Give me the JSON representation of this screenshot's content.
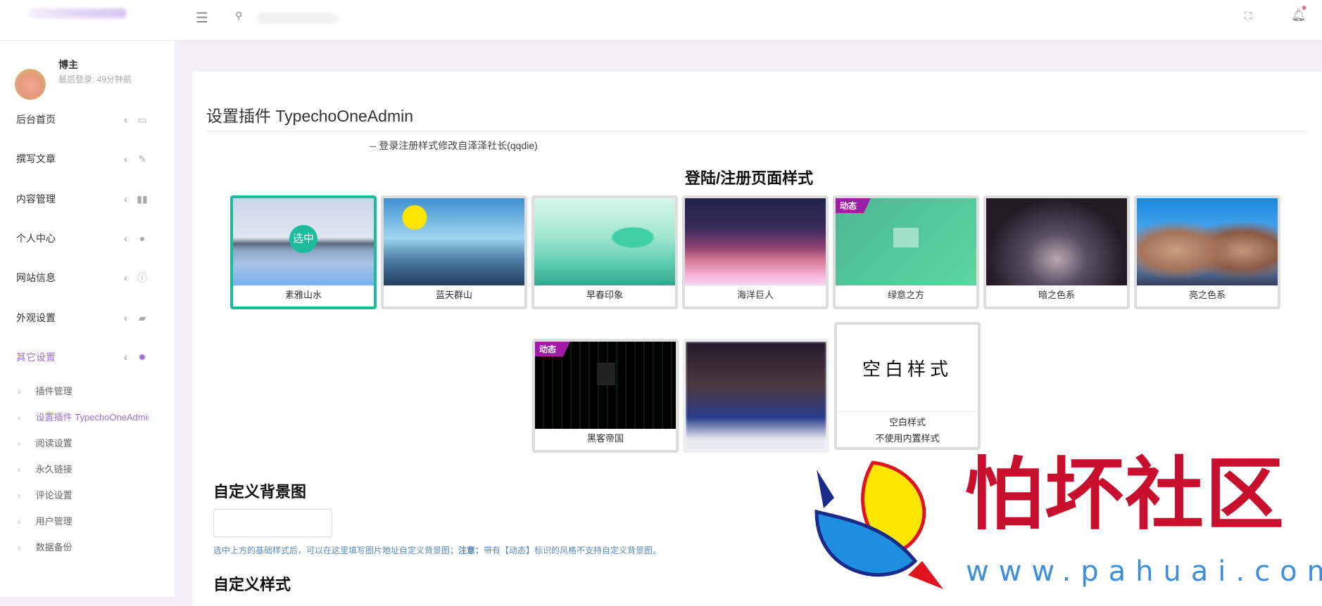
{
  "header": {
    "menu_icon": "hamburger-icon",
    "search_icon": "search-icon",
    "fullscreen_icon": "fullscreen-icon",
    "bell_icon": "bell-icon"
  },
  "user": {
    "name": "博主",
    "last_login": "最后登录: 49分钟前"
  },
  "sidebar": {
    "items": [
      {
        "label": "后台首页",
        "icon": "monitor-icon"
      },
      {
        "label": "撰写文章",
        "icon": "pencil-icon"
      },
      {
        "label": "内容管理",
        "icon": "book-icon"
      },
      {
        "label": "个人中心",
        "icon": "user-icon"
      },
      {
        "label": "网站信息",
        "icon": "info-icon"
      },
      {
        "label": "外观设置",
        "icon": "image-icon"
      },
      {
        "label": "其它设置",
        "icon": "gear-icon",
        "active": true
      }
    ],
    "sub_items": [
      {
        "label": "插件管理"
      },
      {
        "label": "设置插件 TypechoOneAdmin",
        "active": true
      },
      {
        "label": "阅读设置"
      },
      {
        "label": "永久链接"
      },
      {
        "label": "评论设置"
      },
      {
        "label": "用户管理"
      },
      {
        "label": "数据备份"
      }
    ]
  },
  "main": {
    "title": "设置插件 TypechoOneAdmin",
    "subtitle": "-- 登录注册样式修改自泽泽社长(qqdie)",
    "style_heading": "登陆/注册页面样式",
    "selected_label": "选中",
    "dynamic_badge": "动态",
    "templates": [
      {
        "name": "素雅山水",
        "selected": true
      },
      {
        "name": "蓝天群山"
      },
      {
        "name": "早春印象"
      },
      {
        "name": "海洋巨人"
      },
      {
        "name": "绿意之方",
        "dynamic": true
      },
      {
        "name": "暗之色系"
      },
      {
        "name": "亮之色系"
      },
      {
        "name": "黑客帝国",
        "dynamic": true
      },
      {
        "name": ""
      },
      {
        "name": "空白样式",
        "desc": "不使用内置样式",
        "preview_text": "空白样式"
      }
    ],
    "bg_heading": "自定义背景图",
    "bg_input_value": "",
    "bg_help": "选中上方的基础样式后，可以在这里填写图片地址自定义背景图；",
    "bg_help_note_label": "注意：",
    "bg_help_note": "带有【动态】标识的风格不支持自定义背景图。",
    "css_heading": "自定义样式"
  },
  "watermark": {
    "name": "怕坏社区",
    "url": "www.pahuai.com"
  }
}
